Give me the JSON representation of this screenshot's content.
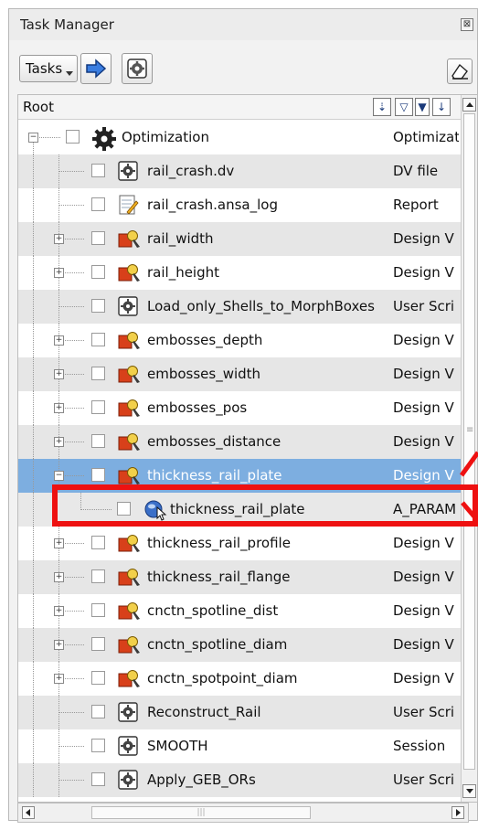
{
  "window": {
    "title": "Task Manager",
    "close_glyph": "⊠"
  },
  "toolbar": {
    "tasks_label": "Tasks",
    "buttons": [
      "arrow-right-icon",
      "gear-icon",
      "eraser-icon"
    ]
  },
  "tree": {
    "header": {
      "root_label": "Root",
      "buttons": [
        "sort-icon",
        "filter-icon",
        "dropdown-icon",
        "down-arrow-icon"
      ]
    },
    "rows": [
      {
        "label": "Optimization",
        "type": "Optimizat",
        "icon": "optimization-gear-icon",
        "expander": "⊟"
      },
      {
        "label": "rail_crash.dv",
        "type": "DV file",
        "icon": "script-gear-icon"
      },
      {
        "label": "rail_crash.ansa_log",
        "type": "Report",
        "icon": "report-pencil-icon"
      },
      {
        "label": "rail_width",
        "type": "Design V",
        "icon": "design-variable-icon",
        "expander": "⊞"
      },
      {
        "label": "rail_height",
        "type": "Design V",
        "icon": "design-variable-icon",
        "expander": "⊞"
      },
      {
        "label": "Load_only_Shells_to_MorphBoxes",
        "type": "User Scri",
        "icon": "script-gear-icon"
      },
      {
        "label": "embosses_depth",
        "type": "Design V",
        "icon": "design-variable-icon",
        "expander": "⊞"
      },
      {
        "label": "embosses_width",
        "type": "Design V",
        "icon": "design-variable-icon",
        "expander": "⊞"
      },
      {
        "label": "embosses_pos",
        "type": "Design V",
        "icon": "design-variable-icon",
        "expander": "⊞"
      },
      {
        "label": "embosses_distance",
        "type": "Design V",
        "icon": "design-variable-icon",
        "expander": "⊞"
      },
      {
        "label": "thickness_rail_plate",
        "type": "Design V",
        "icon": "design-variable-icon",
        "expander": "⊟",
        "selected": true
      },
      {
        "label": "thickness_rail_plate",
        "type": "A_PARAM",
        "icon": "parameter-cursor-icon",
        "child": true
      },
      {
        "label": "thickness_rail_profile",
        "type": "Design V",
        "icon": "design-variable-icon",
        "expander": "⊞"
      },
      {
        "label": "thickness_rail_flange",
        "type": "Design V",
        "icon": "design-variable-icon",
        "expander": "⊞"
      },
      {
        "label": "cnctn_spotline_dist",
        "type": "Design V",
        "icon": "design-variable-icon",
        "expander": "⊞"
      },
      {
        "label": "cnctn_spotline_diam",
        "type": "Design V",
        "icon": "design-variable-icon",
        "expander": "⊞"
      },
      {
        "label": "cnctn_spotpoint_diam",
        "type": "Design V",
        "icon": "design-variable-icon",
        "expander": "⊞"
      },
      {
        "label": "Reconstruct_Rail",
        "type": "User Scri",
        "icon": "script-gear-icon"
      },
      {
        "label": "SMOOTH",
        "type": "Session",
        "icon": "script-gear-icon"
      },
      {
        "label": "Apply_GEB_ORs",
        "type": "User Scri",
        "icon": "script-gear-icon"
      }
    ]
  },
  "colors": {
    "selected_row": "#7daee0",
    "alt_row": "#e6e6e6",
    "highlight": "#ee1111"
  }
}
